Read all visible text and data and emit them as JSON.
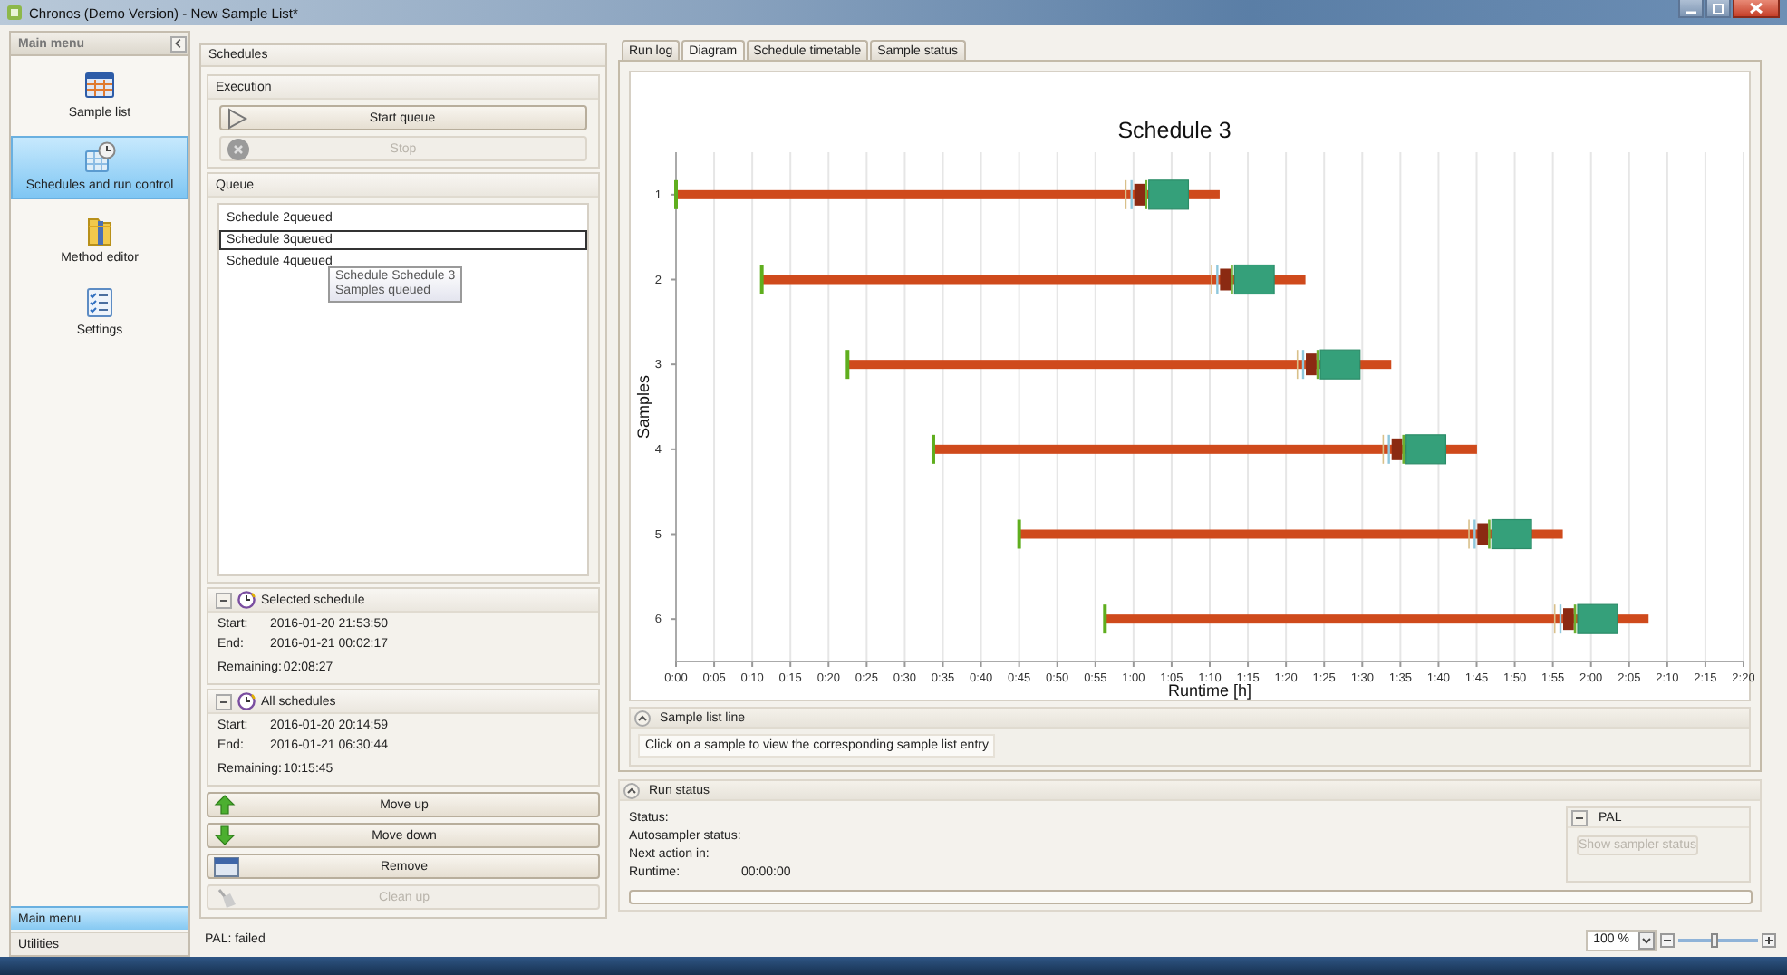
{
  "window": {
    "title": "Chronos (Demo Version) - New Sample List*"
  },
  "sidebar": {
    "header": "Main menu",
    "items": [
      {
        "label": "Sample list",
        "selected": false
      },
      {
        "label": "Schedules and run control",
        "selected": true
      },
      {
        "label": "Method editor",
        "selected": false
      },
      {
        "label": "Settings",
        "selected": false
      }
    ],
    "bottom_tabs": [
      {
        "label": "Main menu",
        "selected": true
      },
      {
        "label": "Utilities",
        "selected": false
      }
    ]
  },
  "schedules_panel": {
    "title": "Schedules",
    "execution": {
      "title": "Execution",
      "buttons": [
        {
          "label": "Start queue",
          "disabled": false
        },
        {
          "label": "Stop",
          "disabled": true
        }
      ]
    },
    "queue": {
      "title": "Queue",
      "items": [
        {
          "name": "Schedule 2",
          "status": "queued",
          "selected": false
        },
        {
          "name": "Schedule 3",
          "status": "queued",
          "selected": true
        },
        {
          "name": "Schedule 4",
          "status": "queued",
          "selected": false
        }
      ],
      "tooltip": [
        "Schedule Schedule 3",
        "Samples queued"
      ]
    },
    "selected_schedule": {
      "title": "Selected schedule",
      "expanded": true,
      "fields": [
        {
          "label": "Start:",
          "value": "2016-01-20 21:53:50"
        },
        {
          "label": "End:",
          "value": "2016-01-21 00:02:17"
        },
        {
          "label": "Remaining:",
          "value": "02:08:27"
        }
      ]
    },
    "all_schedules": {
      "title": "All schedules",
      "expanded": true,
      "fields": [
        {
          "label": "Start:",
          "value": "2016-01-20 20:14:59"
        },
        {
          "label": "End:",
          "value": "2016-01-21 06:30:44"
        },
        {
          "label": "Remaining:",
          "value": "10:15:45"
        }
      ]
    },
    "actions": [
      {
        "label": "Move up",
        "disabled": false
      },
      {
        "label": "Move down",
        "disabled": false
      },
      {
        "label": "Remove",
        "disabled": false
      },
      {
        "label": "Clean up",
        "disabled": true
      }
    ]
  },
  "tabs": [
    {
      "label": "Run log",
      "selected": false
    },
    {
      "label": "Diagram",
      "selected": true
    },
    {
      "label": "Schedule timetable",
      "selected": false
    },
    {
      "label": "Sample status",
      "selected": false
    }
  ],
  "diagram": {
    "title": "Schedule 3",
    "ylabel": "Samples",
    "xlabel": "Runtime [h]",
    "rows": [
      "1",
      "2",
      "3",
      "4",
      "5",
      "6"
    ],
    "xticks": [
      "0:00",
      "0:05",
      "0:10",
      "0:15",
      "0:20",
      "0:25",
      "0:30",
      "0:35",
      "0:40",
      "0:45",
      "0:50",
      "0:55",
      "1:00",
      "1:05",
      "1:10",
      "1:15",
      "1:20",
      "1:25",
      "1:30",
      "1:35",
      "1:40",
      "1:45",
      "1:50",
      "1:55",
      "2:00",
      "2:05",
      "2:10",
      "2:15",
      "2:20"
    ]
  },
  "sample_list_line": {
    "title": "Sample list line",
    "expanded": true,
    "hint": "Click on a sample to view the corresponding sample list entry"
  },
  "run_status": {
    "title": "Run status",
    "expanded": true,
    "fields": [
      {
        "label": "Status:"
      },
      {
        "label": "Autosampler status:"
      },
      {
        "label": "Next action in:"
      },
      {
        "label": "Runtime:",
        "value": "00:00:00"
      }
    ],
    "pal": {
      "title": "PAL",
      "expanded": true,
      "button": {
        "label": "Show sampler status",
        "disabled": true
      }
    },
    "progress": {
      "level": 0
    }
  },
  "status_bar": {
    "text": "PAL: failed",
    "zoom": {
      "value": "100 %",
      "level": 0.45
    }
  }
}
